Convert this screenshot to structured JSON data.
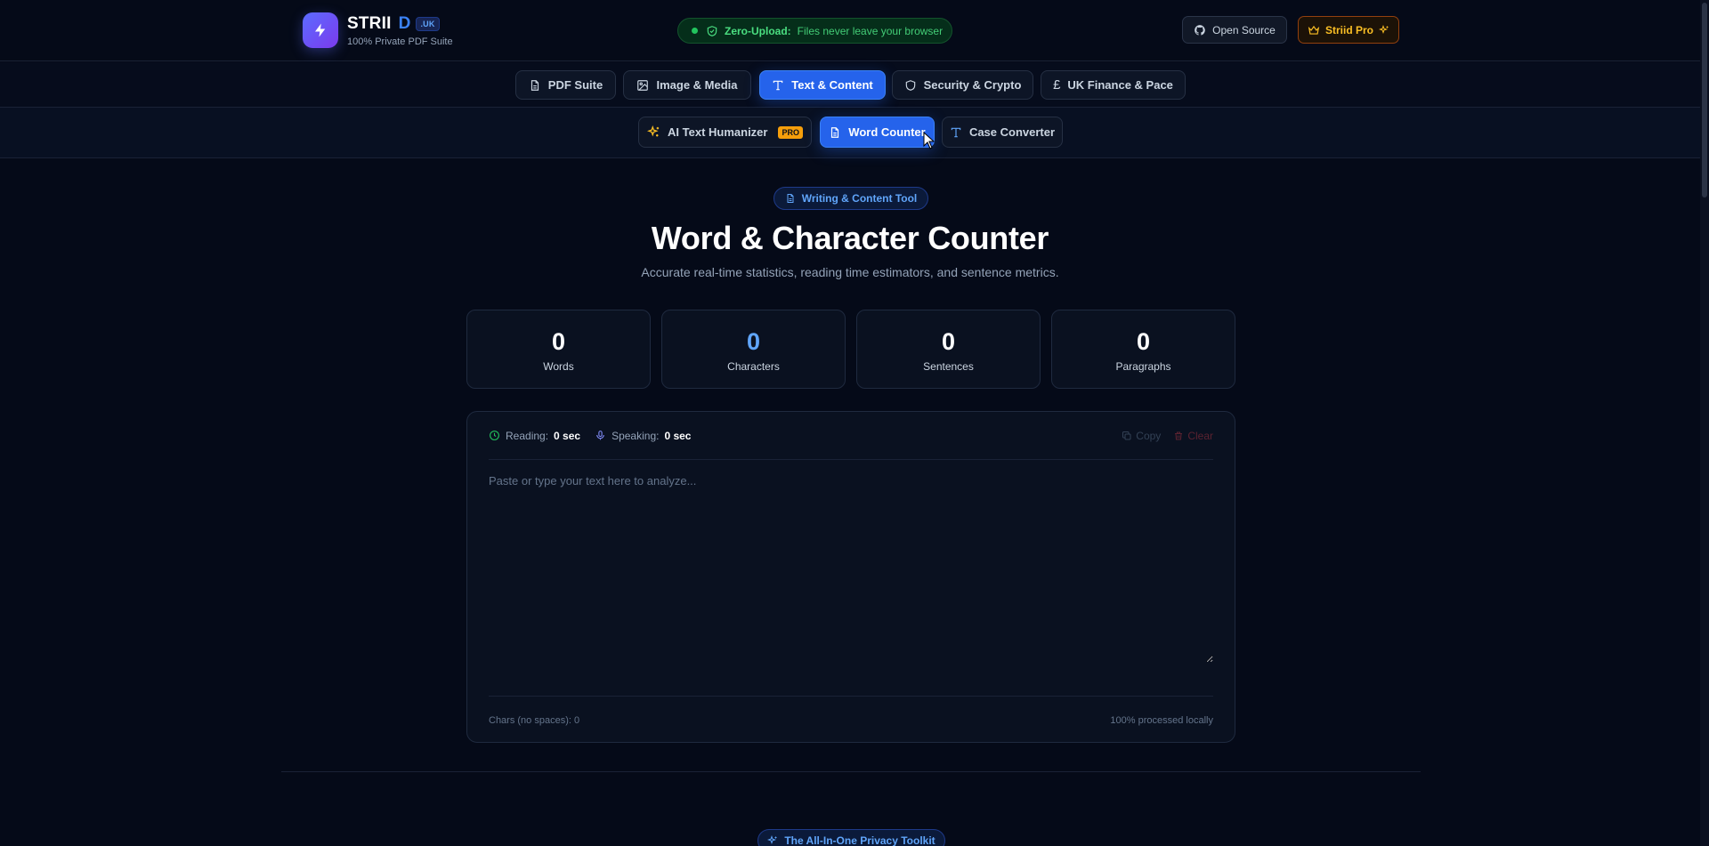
{
  "header": {
    "brand_name": "STRII",
    "brand_d": "D",
    "brand_tld": ".UK",
    "brand_tagline": "100% Private PDF Suite",
    "zero_upload_label": "Zero-Upload:",
    "zero_upload_text": "Files never leave your browser",
    "open_source_label": "Open Source",
    "pro_label": "Striid Pro"
  },
  "nav": {
    "categories": [
      {
        "label": "PDF Suite",
        "icon": "file-text-icon"
      },
      {
        "label": "Image & Media",
        "icon": "image-icon"
      },
      {
        "label": "Text & Content",
        "icon": "type-icon",
        "active": true
      },
      {
        "label": "Security & Crypto",
        "icon": "shield-icon"
      },
      {
        "label": "UK Finance & Pace",
        "icon": "pound-icon"
      }
    ],
    "tools": [
      {
        "label": "AI Text Humanizer",
        "icon": "sparkles-icon",
        "badge": "PRO"
      },
      {
        "label": "Word Counter",
        "icon": "file-text-icon",
        "active": true
      },
      {
        "label": "Case Converter",
        "icon": "type-icon"
      }
    ]
  },
  "hero": {
    "chip_label": "Writing & Content Tool",
    "title": "Word & Character Counter",
    "subtitle": "Accurate real-time statistics, reading time estimators, and sentence metrics."
  },
  "stats": [
    {
      "value": "0",
      "label": "Words"
    },
    {
      "value": "0",
      "label": "Characters"
    },
    {
      "value": "0",
      "label": "Sentences"
    },
    {
      "value": "0",
      "label": "Paragraphs"
    }
  ],
  "editor": {
    "reading_label": "Reading:",
    "reading_value": "0 sec",
    "speaking_label": "Speaking:",
    "speaking_value": "0 sec",
    "copy_label": "Copy",
    "clear_label": "Clear",
    "placeholder": "Paste or type your text here to analyze...",
    "value": "",
    "chars_no_spaces": "Chars (no spaces): 0",
    "local_note": "100% processed locally"
  },
  "footer": {
    "chip_label": "The All-In-One Privacy Toolkit"
  },
  "colors": {
    "background": "#050a18",
    "accent": "#2563eb",
    "success": "#22c55e",
    "pro": "#f59e0b"
  }
}
